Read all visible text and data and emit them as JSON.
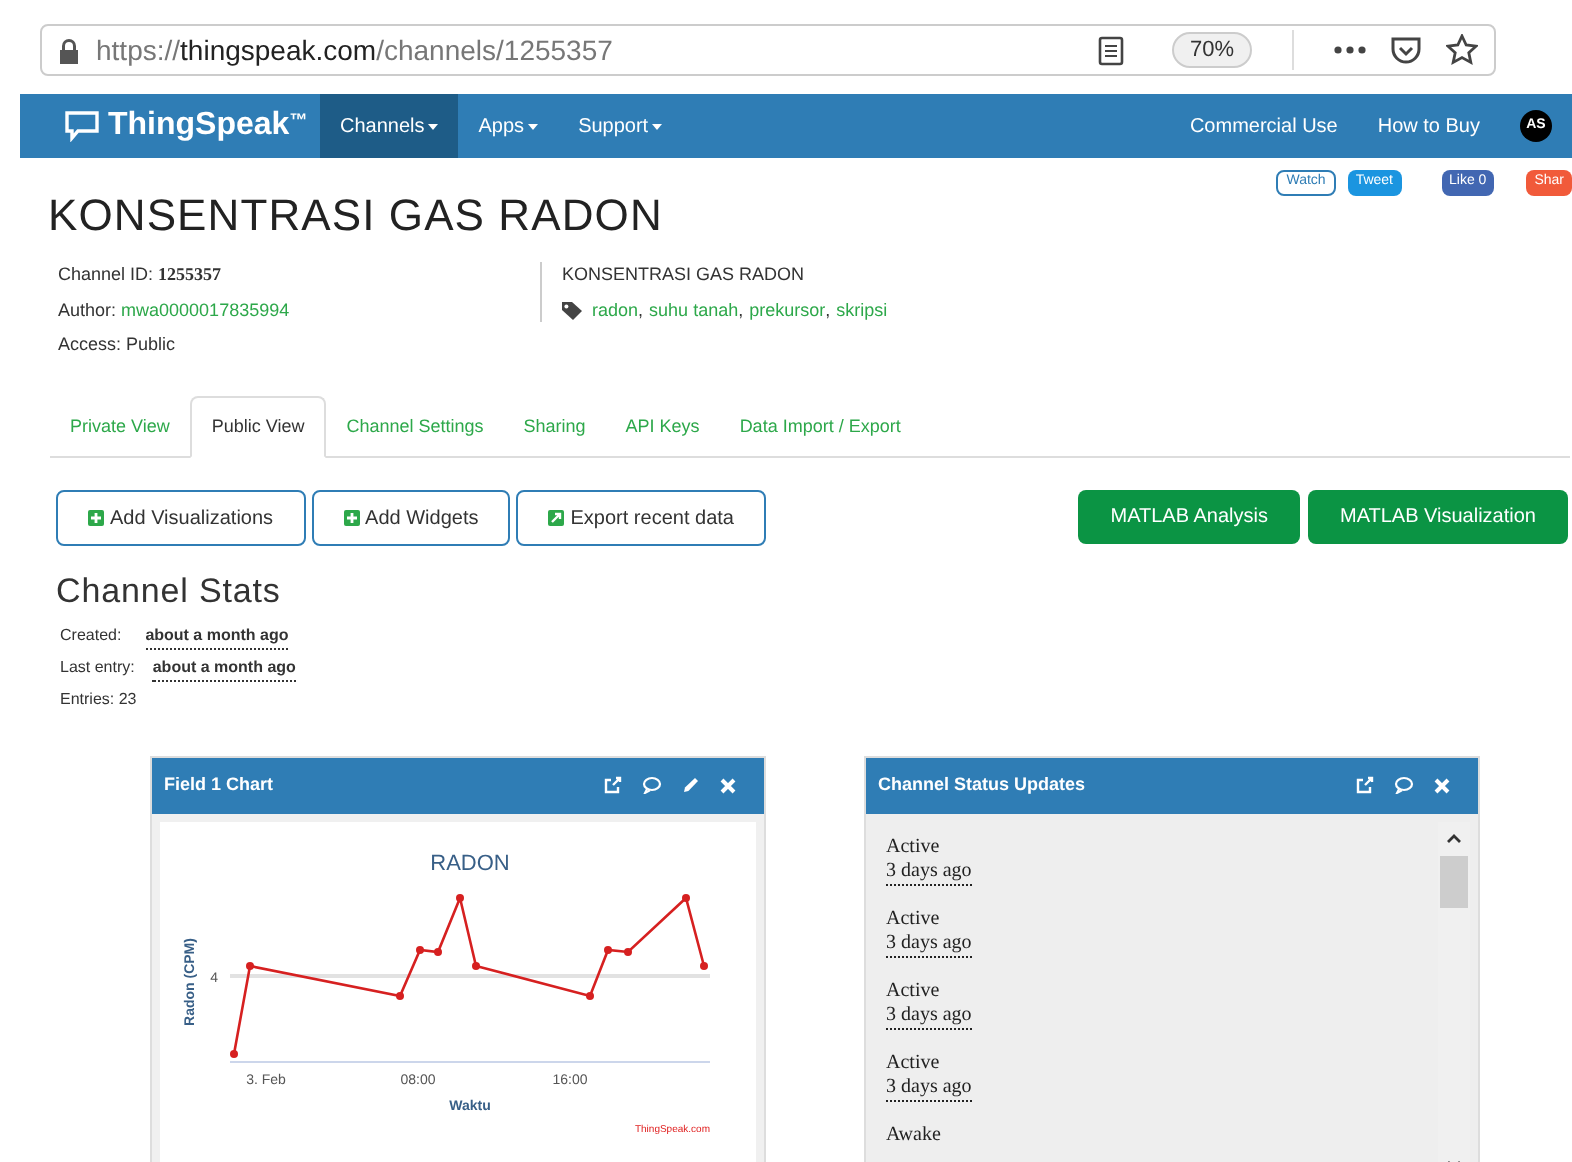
{
  "browser": {
    "url_prefix": "https://",
    "url_host": "thingspeak.com",
    "url_path": "/channels/1255357",
    "zoom": "70%"
  },
  "navbar": {
    "brand": "ThingSpeak",
    "trademark": "™",
    "items": [
      {
        "label": "Channels",
        "selected": true
      },
      {
        "label": "Apps",
        "selected": false
      },
      {
        "label": "Support",
        "selected": false
      }
    ],
    "right_links": [
      "Commercial Use",
      "How to Buy"
    ],
    "avatar": "AS"
  },
  "social": [
    {
      "kind": "watch",
      "label": "Watch"
    },
    {
      "kind": "tweet",
      "label": "Tweet"
    },
    {
      "kind": "like",
      "label": "Like 0"
    },
    {
      "kind": "share",
      "label": "Shar"
    }
  ],
  "title": "KONSENTRASI GAS RADON",
  "info": {
    "channel_id_label": "Channel ID:",
    "channel_id": "1255357",
    "author_label": "Author:",
    "author": "mwa0000017835994",
    "access": "Access: Public",
    "description": "KONSENTRASI GAS RADON",
    "tags": [
      "radon",
      "suhu tanah",
      "prekursor",
      "skripsi"
    ],
    "tag_separator": ","
  },
  "tabs": [
    {
      "label": "Private View",
      "selected": false
    },
    {
      "label": "Public View",
      "selected": true
    },
    {
      "label": "Channel Settings",
      "selected": false
    },
    {
      "label": "Sharing",
      "selected": false
    },
    {
      "label": "API Keys",
      "selected": false
    },
    {
      "label": "Data Import / Export",
      "selected": false
    }
  ],
  "actions": [
    {
      "kind": "plus",
      "label": "Add Visualizations"
    },
    {
      "kind": "plus",
      "label": "Add Widgets"
    },
    {
      "kind": "export",
      "label": "Export recent data"
    }
  ],
  "matlab_buttons": [
    "MATLAB Analysis",
    "MATLAB Visualization"
  ],
  "stats": {
    "heading": "Channel Stats",
    "created_label": "Created:",
    "created": "about a month ago",
    "last_label": "Last entry:",
    "last": "about a month ago",
    "entries": "Entries: 23"
  },
  "chart_panel": {
    "title": "Field 1 Chart",
    "chart_title": "RADON",
    "ylabel": "Radon (CPM)",
    "ytick": "4",
    "xticks": [
      "3. Feb",
      "08:00",
      "16:00"
    ],
    "xlabel": "Waktu",
    "credit": "ThingSpeak.com"
  },
  "status_panel": {
    "title": "Channel Status Updates",
    "updates": [
      {
        "status": "Active",
        "time": "3 days ago"
      },
      {
        "status": "Active",
        "time": "3 days ago"
      },
      {
        "status": "Active",
        "time": "3 days ago"
      },
      {
        "status": "Active",
        "time": "3 days ago"
      },
      {
        "status": "Awake"
      }
    ]
  }
}
